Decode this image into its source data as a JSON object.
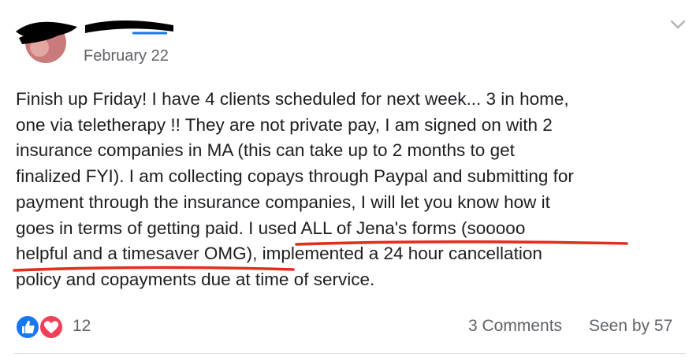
{
  "post": {
    "date": "February 22",
    "text_lines": [
      "Finish up Friday! I have 4 clients scheduled for next week... 3 in home,",
      "one via teletherapy !! They are not private pay, I am signed on with 2",
      "insurance companies in MA (this can take up to 2 months to get",
      "finalized FYI). I am collecting copays through Paypal and submitting for",
      "payment through the insurance companies, I will let you know how it",
      "goes in terms of getting paid. I used ALL of Jena's forms (sooooo",
      "helpful and a timesaver OMG), implemented a 24 hour cancellation",
      "policy and copayments due at time of service."
    ]
  },
  "footer": {
    "reaction_count": "12",
    "comments": "3 Comments",
    "seen_by": "Seen by 57"
  },
  "icons": {
    "like": "like-icon",
    "love": "love-icon",
    "menu": "chevron-down-icon"
  },
  "colors": {
    "underline": "#e0301e",
    "like_blue": "#1877f2",
    "love_red": "#f33e58",
    "muted_text": "#5f6368"
  }
}
